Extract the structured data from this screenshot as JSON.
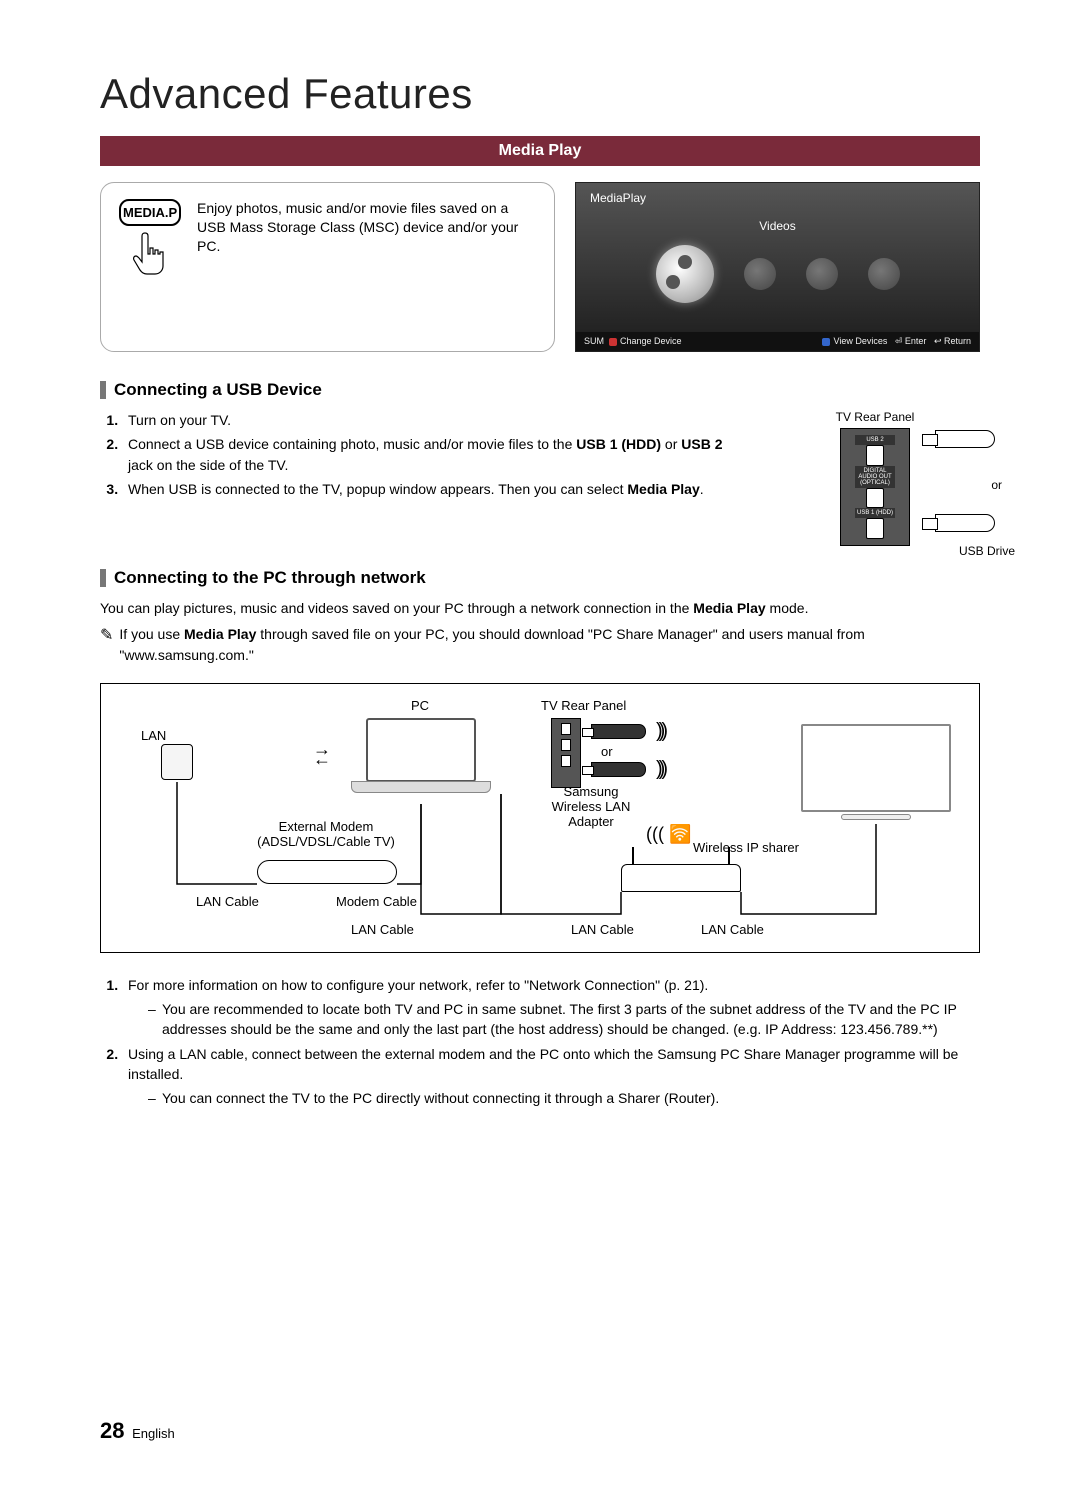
{
  "page": {
    "title": "Advanced Features",
    "section_bar": "Media Play",
    "number": "28",
    "language": "English"
  },
  "mediap": {
    "button_label": "MEDIA.P",
    "description": "Enjoy photos, music and/or movie files saved on a USB Mass Storage Class (MSC) device and/or your PC."
  },
  "tvshot": {
    "app": "MediaPlay",
    "category": "Videos",
    "footer_left_sum": "SUM",
    "footer_left_change": "Change Device",
    "footer_right_view": "View Devices",
    "footer_right_enter": "Enter",
    "footer_right_return": "Return"
  },
  "sec1": {
    "heading": "Connecting a USB Device",
    "step1": "Turn on your TV.",
    "step2_a": "Connect a USB device containing photo, music and/or movie files to the ",
    "step2_b": "USB 1 (HDD)",
    "step2_c": " or ",
    "step2_d": "USB 2",
    "step2_e": " jack on the side of the TV.",
    "step3_a": "When USB is connected to the TV, popup window appears. Then you can select ",
    "step3_b": "Media Play",
    "step3_c": ".",
    "diag_title": "TV Rear Panel",
    "port_usb2": "USB 2",
    "port_audio": "DIGITAL AUDIO OUT (OPTICAL)",
    "port_usb1": "USB 1 (HDD)",
    "or": "or",
    "usb_drive": "USB Drive"
  },
  "sec2": {
    "heading": "Connecting to the PC through network",
    "intro_a": "You can play pictures, music and videos saved on your PC through a network connection in the ",
    "intro_b": "Media Play",
    "intro_c": " mode.",
    "note_a": "If you use ",
    "note_b": "Media Play",
    "note_c": " through saved file on your PC, you should download \"PC Share Manager\" and users manual from \"www.samsung.com.\"",
    "labels": {
      "lan": "LAN",
      "pc": "PC",
      "rear": "TV Rear Panel",
      "modem": "External Modem (ADSL/VDSL/Cable TV)",
      "adapter": "Samsung Wireless LAN Adapter",
      "router": "Wireless IP sharer",
      "lan_cable": "LAN Cable",
      "modem_cable": "Modem Cable",
      "or": "or"
    },
    "step1": "For more information on how to configure your network, refer to \"Network Connection\" (p. 21).",
    "step1_sub1": "You are recommended to locate both TV and PC in same subnet. The first 3 parts of the subnet address of the TV and the PC IP addresses should be the same and only the last part (the host address) should be changed. (e.g. IP Address: 123.456.789.**)",
    "step2": "Using a LAN cable, connect between the external modem and the PC onto which the Samsung PC Share Manager programme will be installed.",
    "step2_sub1": "You can connect the TV to the PC directly without connecting it through a Sharer (Router)."
  }
}
